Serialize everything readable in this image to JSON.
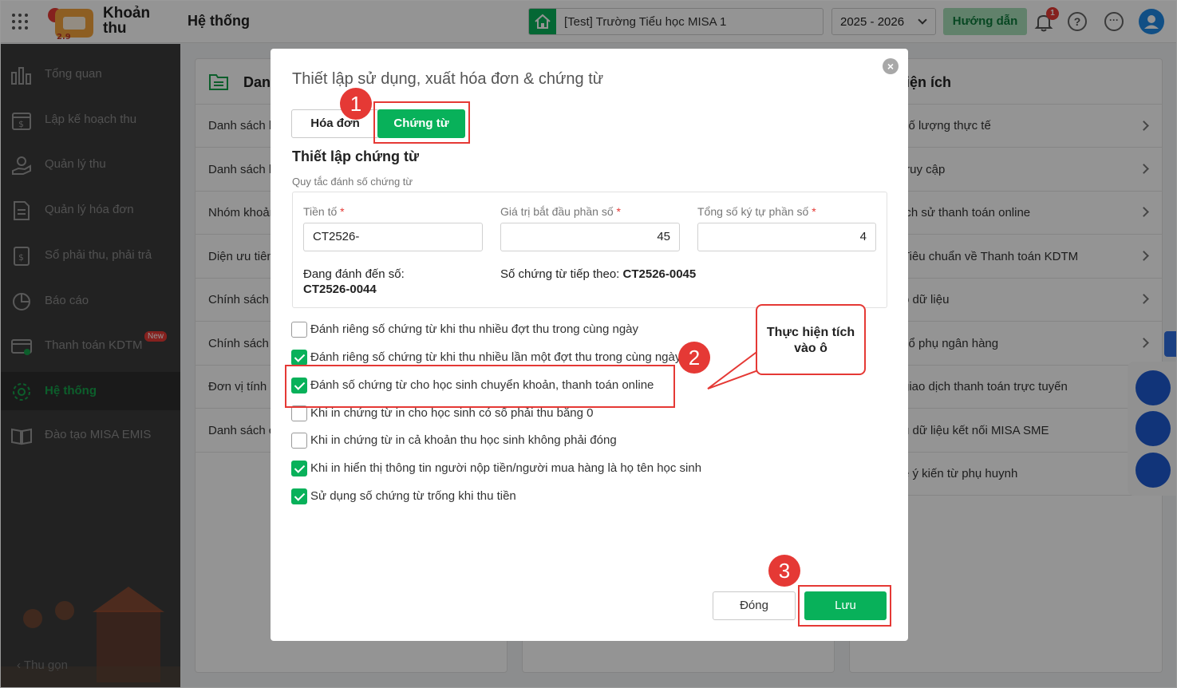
{
  "app": {
    "name_line1": "Khoản",
    "name_line2": "thu",
    "page_title": "Hệ thống"
  },
  "topbar": {
    "school": "[Test] Trường Tiểu học MISA 1",
    "year": "2025 - 2026",
    "guide_button": "Hướng dẫn",
    "notification_count": "1"
  },
  "sidebar": {
    "items": [
      {
        "label": "Tổng quan",
        "icon": "chart-bars-icon"
      },
      {
        "label": "Lập kế hoạch thu",
        "icon": "calendar-money-icon"
      },
      {
        "label": "Quản lý thu",
        "icon": "hand-coin-icon"
      },
      {
        "label": "Quản lý hóa đơn",
        "icon": "invoice-icon"
      },
      {
        "label": "Sổ phải thu, phải trả",
        "icon": "ledger-icon"
      },
      {
        "label": "Báo cáo",
        "icon": "pie-chart-icon"
      },
      {
        "label": "Thanh toán KDTM",
        "icon": "card-icon",
        "badge": "New"
      },
      {
        "label": "Hệ thống",
        "icon": "gear-icon",
        "active": true
      },
      {
        "label": "Đào tạo MISA EMIS",
        "icon": "book-icon"
      }
    ],
    "collapse": "Thu gọn"
  },
  "background": {
    "left_card_title": "Dan",
    "left_rows": [
      "Danh sách h",
      "Danh sách l",
      "Nhóm khoản",
      "Diện ưu tiên",
      "Chính sách",
      "Chính sách",
      "Đơn vị tính",
      "Danh sách c"
    ],
    "right_card_title": "iện ích",
    "right_rows": [
      " số lượng thực tế",
      "truy cập",
      "ịch sử thanh toán online",
      " Tiêu chuẩn về Thanh toán KDTM",
      "o dữ liệu",
      " sổ phụ ngân hàng",
      " giao dịch thanh toán trực tuyến",
      "u dữ liệu kết nối MISA SME",
      "ề ý kiến từ phụ huynh"
    ]
  },
  "modal": {
    "title": "Thiết lập sử dụng, xuất hóa đơn & chứng từ",
    "tabs": {
      "invoice": "Hóa đơn",
      "voucher": "Chứng từ"
    },
    "section_title": "Thiết lập chứng từ",
    "rule_caption": "Quy tắc đánh số chứng từ",
    "fields": {
      "prefix": {
        "label": "Tiền tố",
        "value": "CT2526-"
      },
      "start_value": {
        "label": "Giá trị bắt đầu phần số",
        "value": "45"
      },
      "digits": {
        "label": "Tổng số ký tự phần số",
        "value": "4"
      }
    },
    "required_mark": "*",
    "current_label": "Đang đánh đến số:",
    "current_value": "CT2526-0044",
    "next_label": "Số chứng từ tiếp theo:",
    "next_value": "CT2526-0045",
    "options": [
      {
        "label": "Đánh riêng số chứng từ khi thu nhiều đợt thu trong cùng ngày",
        "checked": false
      },
      {
        "label": "Đánh riêng số chứng từ khi thu nhiều lần một đợt thu trong cùng ngày",
        "checked": true
      },
      {
        "label": "Đánh số chứng từ cho học sinh chuyển khoản, thanh toán online",
        "checked": true
      },
      {
        "label": "Khi in chứng từ in cho học sinh có số phải thu bằng 0",
        "checked": false
      },
      {
        "label": "Khi in chứng từ in cả khoản thu học sinh không phải đóng",
        "checked": false
      },
      {
        "label": "Khi in hiển thị thông tin người nộp tiền/người mua hàng là họ tên học sinh",
        "checked": true
      },
      {
        "label": "Sử dụng số chứng từ trống khi thu tiền",
        "checked": true
      }
    ],
    "buttons": {
      "close": "Đóng",
      "save": "Lưu"
    }
  },
  "annotations": {
    "step1": "1",
    "step2": "2",
    "step3": "3",
    "callout_line1": "Thực hiện tích",
    "callout_line2": "vào ô",
    "color": "#e53935"
  },
  "colors": {
    "accent": "#08b15a",
    "sidebar_bg": "#3c3c3c",
    "highlight": "#e53935"
  }
}
